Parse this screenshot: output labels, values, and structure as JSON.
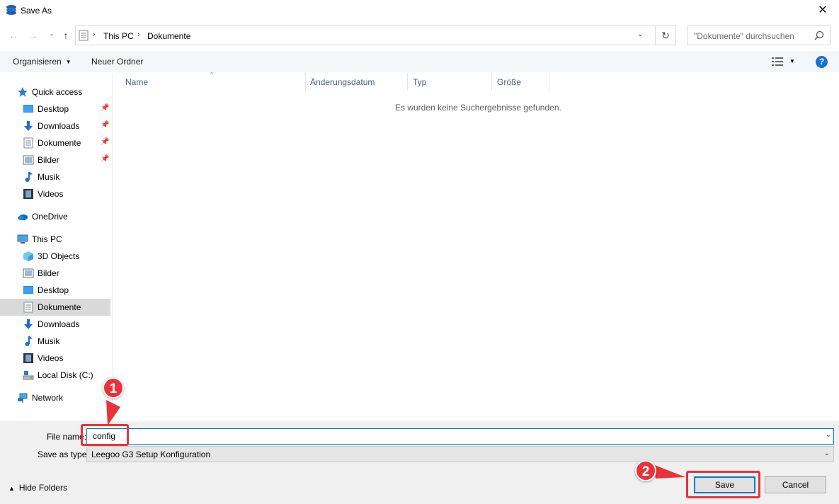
{
  "window": {
    "title": "Save As"
  },
  "address": {
    "crumbs": [
      "This PC",
      "Dokumente"
    ]
  },
  "search": {
    "placeholder": "\"Dokumente\" durchsuchen"
  },
  "toolbar": {
    "organize": "Organisieren",
    "new_folder": "Neuer Ordner"
  },
  "sidebar": {
    "items": [
      {
        "label": "Quick access"
      },
      {
        "label": "Desktop"
      },
      {
        "label": "Downloads"
      },
      {
        "label": "Dokumente"
      },
      {
        "label": "Bilder"
      },
      {
        "label": "Musik"
      },
      {
        "label": "Videos"
      },
      {
        "label": "OneDrive"
      },
      {
        "label": "This PC"
      },
      {
        "label": "3D Objects"
      },
      {
        "label": "Bilder"
      },
      {
        "label": "Desktop"
      },
      {
        "label": "Dokumente"
      },
      {
        "label": "Downloads"
      },
      {
        "label": "Musik"
      },
      {
        "label": "Videos"
      },
      {
        "label": "Local Disk (C:)"
      },
      {
        "label": "Network"
      }
    ]
  },
  "columns": {
    "name": "Name",
    "date": "Änderungsdatum",
    "type": "Typ",
    "size": "Größe"
  },
  "content": {
    "empty_message": "Es wurden keine Suchergebnisse gefunden."
  },
  "form": {
    "filename_label": "File name:",
    "filename_value": "config",
    "savetype_label": "Save as type:",
    "savetype_value": "Leegoo G3 Setup Konfiguration"
  },
  "footer": {
    "hide_folders": "Hide Folders",
    "save": "Save",
    "cancel": "Cancel"
  },
  "annotations": {
    "badge1": "1",
    "badge2": "2",
    "color": "#e8333a"
  },
  "colors": {
    "accent": "#0078d7",
    "selected_bg": "#d9d9d9"
  }
}
